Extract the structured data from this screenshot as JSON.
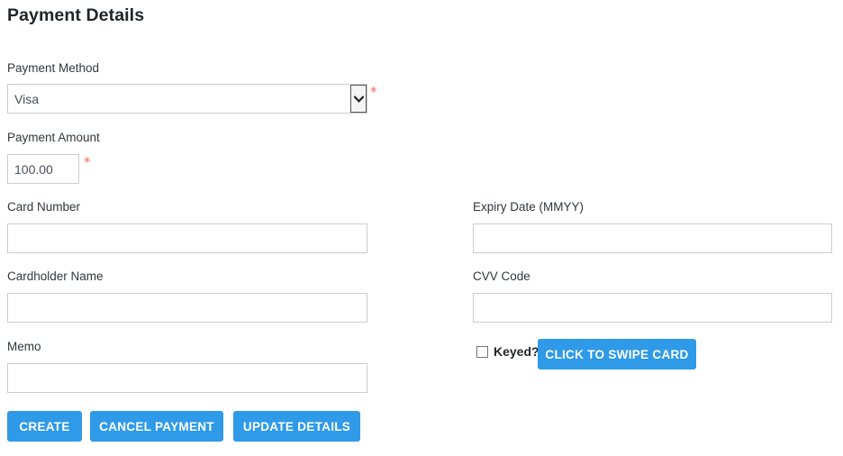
{
  "page": {
    "title": "Payment Details",
    "required_marker": "*",
    "accent_blue": "#2f9ae8",
    "required_star_color": "#fa6a5a",
    "input_border_color": "#cdcdcd",
    "text_color": "#212529"
  },
  "form": {
    "payment_method": {
      "label": "Payment Method",
      "value": "Visa",
      "options": [
        "Visa"
      ],
      "required": true
    },
    "payment_amount": {
      "label": "Payment Amount",
      "value": "100.00",
      "placeholder": "",
      "required": true
    },
    "card_number": {
      "label": "Card Number",
      "value": "",
      "placeholder": ""
    },
    "cardholder_name": {
      "label": "Cardholder Name",
      "value": "",
      "placeholder": ""
    },
    "memo": {
      "label": "Memo",
      "value": "",
      "placeholder": ""
    },
    "expiry_date": {
      "label": "Expiry Date (MMYY)",
      "value": "",
      "placeholder": ""
    },
    "cvv_code": {
      "label": "CVV Code",
      "value": "",
      "placeholder": ""
    },
    "keyed": {
      "label": "Keyed?",
      "checked": false
    }
  },
  "actions": {
    "swipe_card": "CLICK TO SWIPE CARD",
    "create": "CREATE",
    "cancel_payment": "CANCEL PAYMENT",
    "update_details": "UPDATE DETAILS"
  },
  "icons": {
    "select_chevron": "chevron-down-icon"
  }
}
